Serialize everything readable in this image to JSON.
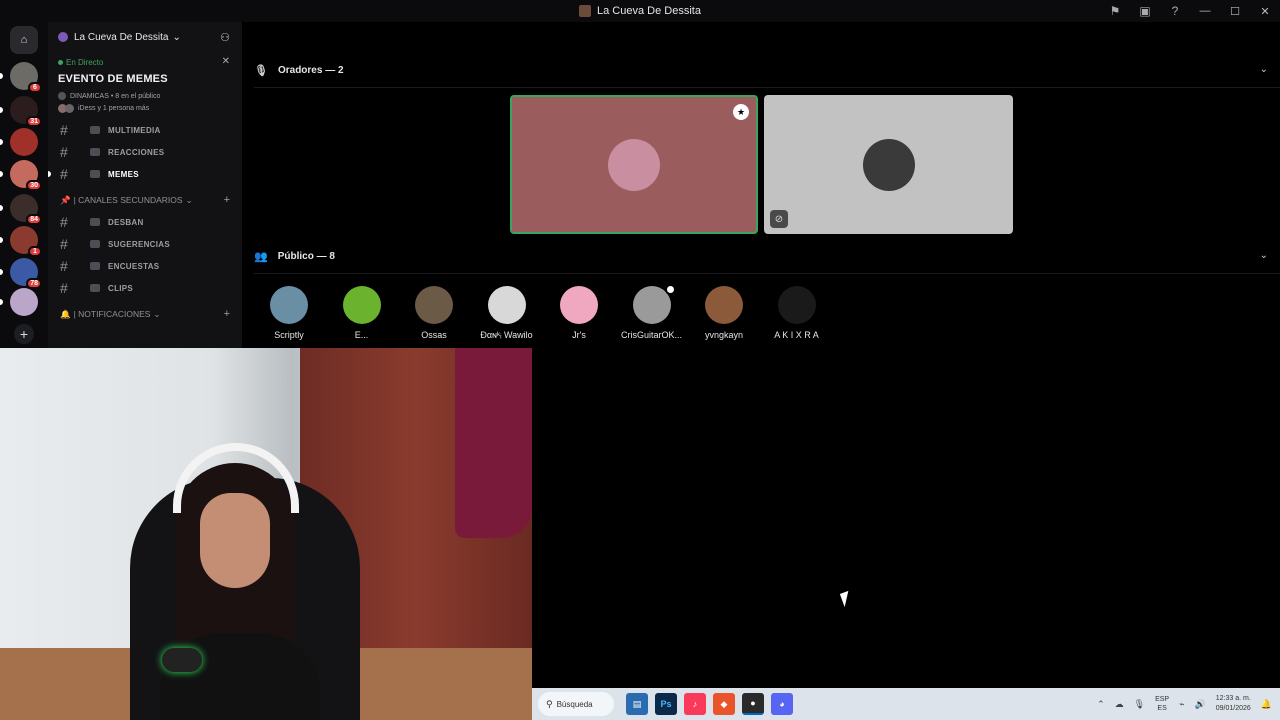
{
  "window": {
    "title": "La Cueva De Dessita"
  },
  "rail": {
    "servers": [
      {
        "badge": "6",
        "color": "#6c6b66"
      },
      {
        "badge": "31",
        "color": "#2b1d1d"
      },
      {
        "badge": "",
        "color": "#a0302a"
      },
      {
        "badge": "30",
        "color": "#c56a5e"
      },
      {
        "badge": "84",
        "color": "#3b2e2a"
      },
      {
        "badge": "1",
        "color": "#8a3a2e"
      },
      {
        "badge": "78",
        "color": "#3b59a5"
      },
      {
        "badge": "",
        "color": "#b9a6c8"
      }
    ],
    "add_label": "+"
  },
  "sidebar": {
    "server_name": "La Cueva De Dessita",
    "event": {
      "live_label": "En Directo",
      "title": "EVENTO DE MEMES",
      "meta": "DINAMICAS • 8 en el público",
      "attendees": "iDess y 1 persona más"
    },
    "channels_top": [
      {
        "name": "MULTIMEDIA"
      },
      {
        "name": "REACCIONES"
      },
      {
        "name": "MEMES",
        "active": true
      }
    ],
    "category_secondary": "| CANALES SECUNDARIOS",
    "channels_secondary": [
      {
        "name": "DESBAN"
      },
      {
        "name": "SUGERENCIAS"
      },
      {
        "name": "ENCUESTAS"
      },
      {
        "name": "CLIPS"
      }
    ],
    "category_notifications": "| NOTIFICACIONES"
  },
  "main": {
    "speakers_label": "Oradores — 2",
    "audience_label": "Público — 8",
    "speakers": [
      {
        "color": "#9a5c5c",
        "avatar_color": "#c98fa0",
        "highlighted": true
      },
      {
        "color": "#c2c2c2",
        "avatar_color": "#3a3a3a",
        "muted": true
      }
    ],
    "audience": [
      {
        "name": "Scriptly",
        "color": "#6a8fa5"
      },
      {
        "name": "E...",
        "color": "#6bb22f"
      },
      {
        "name": "Ossas",
        "color": "#6b5a45"
      },
      {
        "name": "Ðαɴᵏᵢ Wawilo",
        "color": "#d8d8d8"
      },
      {
        "name": "Jr's",
        "color": "#f0a8c0"
      },
      {
        "name": "CrisGuitarOK...",
        "color": "#9a9a9a"
      },
      {
        "name": "yvngkayn",
        "color": "#8a5a3a"
      },
      {
        "name": "A K I X R A",
        "color": "#1a1a1a"
      }
    ]
  },
  "taskbar": {
    "search_label": "Búsqueda",
    "lang_top": "ESP",
    "lang_bottom": "ES",
    "time": "12:33 a. m.",
    "date": "09/01/2026"
  }
}
